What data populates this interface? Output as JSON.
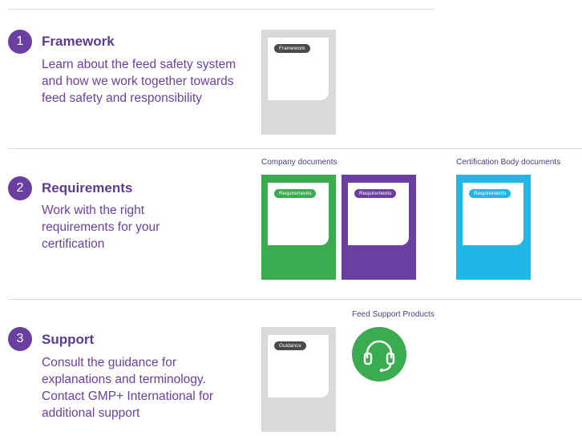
{
  "steps": [
    {
      "number": "1",
      "title": "Framework",
      "description": "Learn about the feed safety system and how we work together towards feed safety and responsibility"
    },
    {
      "number": "2",
      "title": "Requirements",
      "description": "Work with the right requirements for your certification"
    },
    {
      "number": "3",
      "title": "Support",
      "description": "Consult the guidance for explanations and terminology. Contact GMP+ International for additional support"
    }
  ],
  "group_labels": {
    "company_documents": "Company documents",
    "certification_body_documents": "Certification Body documents",
    "feed_support_products": "Feed Support Products"
  },
  "documents": {
    "framework": {
      "tag": "Framework",
      "color": "#d9d9d9",
      "tag_color": "#4a4a4a"
    },
    "requirements_company_green": {
      "tag": "Requirements",
      "color": "#3aab4e",
      "tag_color": "#3aab4e"
    },
    "requirements_company_purple": {
      "tag": "Requirements",
      "color": "#6b3fa0",
      "tag_color": "#6b3fa0"
    },
    "requirements_certification_body": {
      "tag": "Requirements",
      "color": "#1fb8e6",
      "tag_color": "#1fb8e6"
    },
    "guidance": {
      "tag": "Guidance",
      "color": "#d9d9d9",
      "tag_color": "#4a4a4a"
    }
  },
  "support_icon": {
    "name": "headset-icon",
    "color": "#3aab4e"
  },
  "colors": {
    "accent": "#6b3fa0",
    "rule": "#dcdcdc"
  }
}
